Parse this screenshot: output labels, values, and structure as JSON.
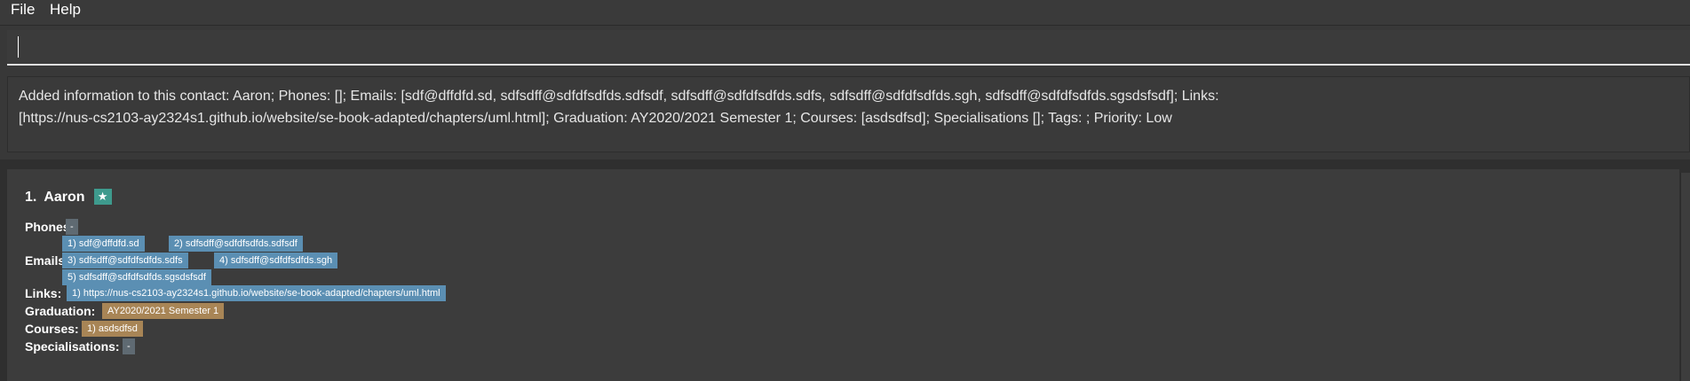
{
  "menu": {
    "file": "File",
    "help": "Help"
  },
  "command": {
    "value": ""
  },
  "result": {
    "line1": "Added information to this contact: Aaron; Phones: []; Emails: [sdf@dffdfd.sd, sdfsdff@sdfdfsdfds.sdfsdf, sdfsdff@sdfdfsdfds.sdfs, sdfsdff@sdfdfsdfds.sgh, sdfsdff@sdfdfsdfds.sgsdsfsdf]; Links:",
    "line2": "[https://nus-cs2103-ay2324s1.github.io/website/se-book-adapted/chapters/uml.html]; Graduation: AY2020/2021 Semester 1; Courses: [asdsdfsd]; Specialisations []; Tags: ; Priority: Low"
  },
  "contact": {
    "index": "1.",
    "name": "Aaron",
    "star": "★",
    "phones_label": "Phones:",
    "phones_empty": "-",
    "emails_label": "Emails:",
    "emails": [
      "1) sdf@dffdfd.sd",
      "2) sdfsdff@sdfdfsdfds.sdfsdf",
      "3) sdfsdff@sdfdfsdfds.sdfs",
      "4) sdfsdff@sdfdfsdfds.sgh",
      "5) sdfsdff@sdfdfsdfds.sgsdsfsdf"
    ],
    "links_label": "Links:",
    "links": [
      "1) https://nus-cs2103-ay2324s1.github.io/website/se-book-adapted/chapters/uml.html"
    ],
    "graduation_label": "Graduation:",
    "graduation": "AY2020/2021 Semester 1",
    "courses_label": "Courses:",
    "courses": [
      "1) asdsdfsd"
    ],
    "specialisations_label": "Specialisations:",
    "specialisations_empty": "-"
  },
  "colors": {
    "email_tag": "#5b8fb3",
    "link_tag": "#5b8fb3",
    "graduation_tag": "#a88556",
    "course_tag": "#a88556",
    "star_badge": "#3e9a8d",
    "empty_tag": "#5f6a72"
  }
}
